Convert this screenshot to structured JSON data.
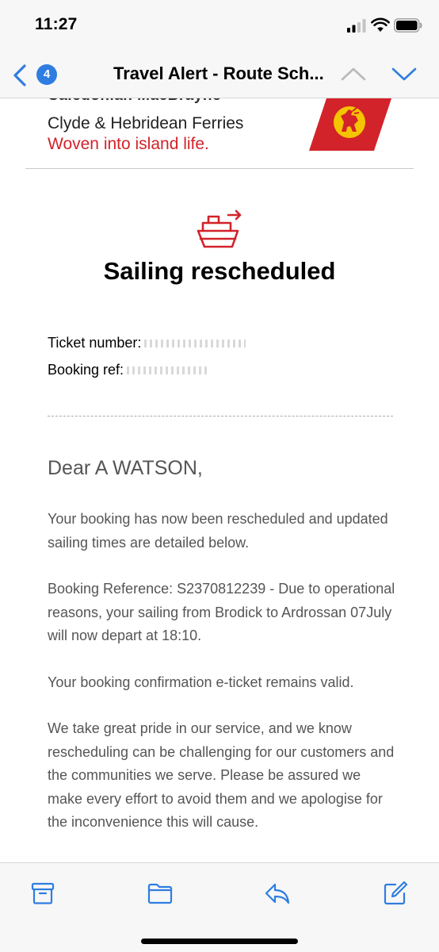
{
  "status_bar": {
    "time": "11:27"
  },
  "nav": {
    "unread_count": "4",
    "title": "Travel Alert - Route Sch..."
  },
  "email": {
    "brand": {
      "name_partial": "Caledonian MacBrayne",
      "line1": "Clyde & Hebridean Ferries",
      "tagline": "Woven into island life."
    },
    "headline": "Sailing rescheduled",
    "ticket_number_label": "Ticket number:",
    "booking_ref_label": "Booking ref:",
    "greeting": "Dear A WATSON,",
    "paragraphs": [
      "Your booking has now been rescheduled and updated sailing times are detailed below.",
      "Booking Reference: S2370812239 - Due to operational reasons, your sailing from Brodick to Ardrossan 07July will now depart at 18:10.",
      "Your booking confirmation e-ticket remains valid.",
      "We take great pride in our service, and we know rescheduling can be challenging for our customers and the communities we serve. Please be assured we make every effort to avoid them and we apologise for the inconvenience this will cause."
    ]
  },
  "colors": {
    "accent_blue": "#2f7de1",
    "brand_red": "#d2232a",
    "brand_yellow": "#f5c400",
    "body_text": "#555555"
  },
  "icons": {
    "back": "chevron-left-icon",
    "previous": "chevron-up-icon",
    "next": "chevron-down-icon",
    "archive": "archive-box-icon",
    "move": "folder-icon",
    "reply": "reply-icon",
    "compose": "compose-icon",
    "ferry": "ferry-icon"
  }
}
